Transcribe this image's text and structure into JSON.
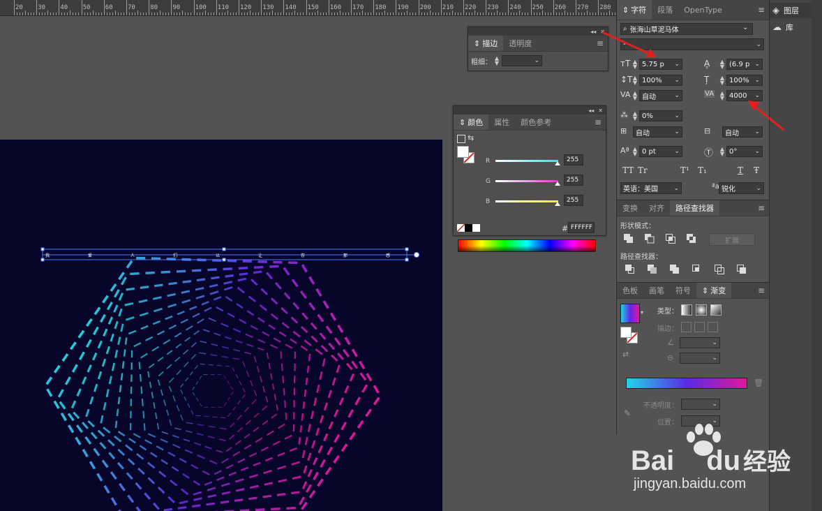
{
  "ruler": {
    "ticks": [
      "20",
      "30",
      "40",
      "50",
      "60",
      "70",
      "80",
      "90",
      "100",
      "110",
      "120",
      "130",
      "140",
      "150",
      "160",
      "170",
      "180",
      "190",
      "200",
      "210",
      "220",
      "230",
      "240",
      "250",
      "260",
      "270",
      "280"
    ]
  },
  "artboard": {
    "text_chars": [
      "我",
      "爱",
      "人",
      "们",
      "以",
      "让",
      "存",
      "那",
      "感"
    ],
    "colors": {
      "bg": "#07052a",
      "cyan": "#24d4e0",
      "purple": "#6a2ee8",
      "magenta": "#e0189a",
      "blue": "#3a52e0"
    }
  },
  "stroke_panel": {
    "tabs": [
      "描边",
      "透明度"
    ],
    "weight_label": "粗细："
  },
  "color_panel": {
    "tabs": [
      "颜色",
      "属性",
      "颜色参考"
    ],
    "channels": [
      {
        "label": "R",
        "value": "255",
        "color": "#30e8f0"
      },
      {
        "label": "G",
        "value": "255",
        "color": "#d040d0"
      },
      {
        "label": "B",
        "value": "255",
        "color": "#f0f020"
      }
    ],
    "hash": "#",
    "hex": "FFFFFF"
  },
  "character_panel": {
    "tabs": [
      "字符",
      "段落",
      "OpenType"
    ],
    "font_family": "张海山草泥马体",
    "font_style": "-",
    "font_size": "5.75 p",
    "leading": "(6.9 p",
    "vscale": "100%",
    "hscale": "100%",
    "kerning": "自动",
    "tracking": "4000",
    "tsume": "0%",
    "aki_left": "自动",
    "aki_right": "自动",
    "baseline": "0 pt",
    "rotation": "0°",
    "language": "英语：美国",
    "antialias": "锐化",
    "type_buttons": [
      "TT",
      "Tr",
      "T¹",
      "T₁",
      "T",
      "Ŧ"
    ]
  },
  "pathfinder_panel": {
    "tabs": [
      "变换",
      "对齐",
      "路径查找器"
    ],
    "shape_modes_label": "形状模式：",
    "expand_label": "扩展",
    "pathfinders_label": "路径查找器："
  },
  "gradient_panel": {
    "tabs": [
      "色板",
      "画笔",
      "符号",
      "渐变"
    ],
    "type_label": "类型：",
    "stroke_label": "描边：",
    "opacity_label": "不透明度：",
    "location_label": "位置："
  },
  "far_right": {
    "layers_label": "图层",
    "library_label": "库"
  },
  "watermark": {
    "brand_a": "Bai",
    "brand_b": "du",
    "brand_cn": "经验",
    "url": "jingyan.baidu.com"
  }
}
